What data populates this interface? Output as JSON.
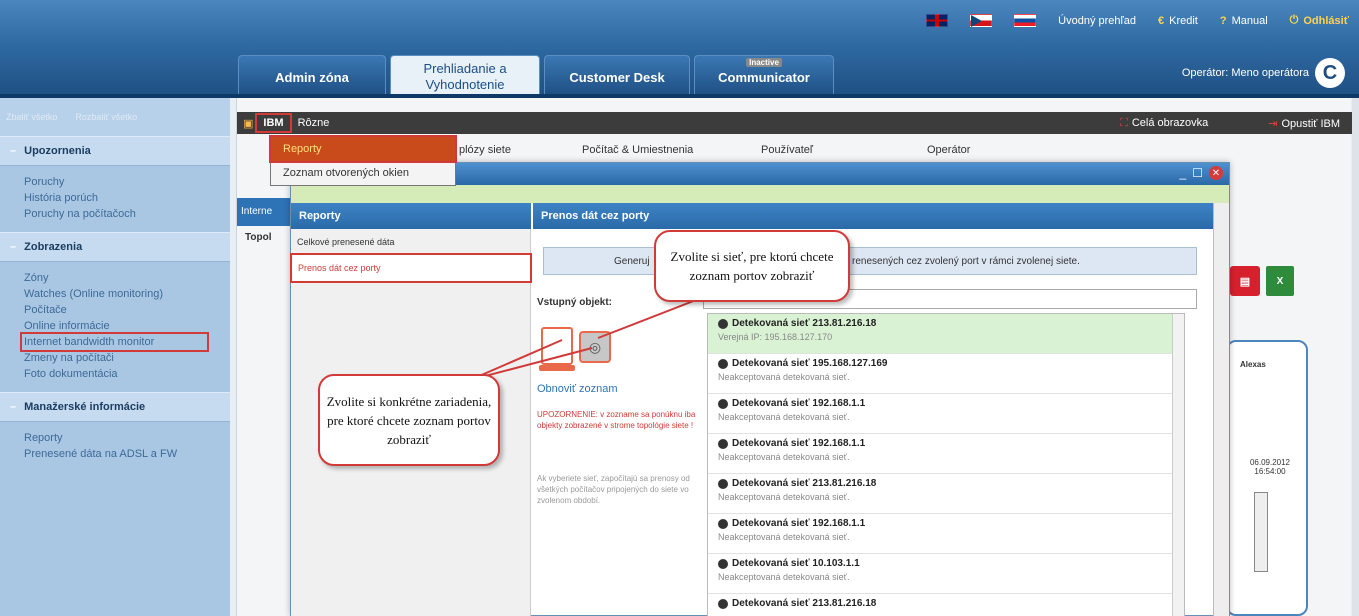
{
  "header": {
    "links": [
      {
        "label": "Úvodný prehľad"
      },
      {
        "label": "Kredit",
        "icon": "€"
      },
      {
        "label": "Manual",
        "icon": "?"
      },
      {
        "label": "Odhlásiť",
        "icon": "⏻"
      }
    ],
    "tabs": [
      {
        "label": "Admin zóna"
      },
      {
        "label": "Prehliadanie a Vyhodnotenie"
      },
      {
        "label": "Customer Desk"
      },
      {
        "label": "Communicator",
        "badge": "Inactive"
      }
    ],
    "operator": "Operátor: Meno operátora",
    "logo_letter": "C"
  },
  "sidebar": {
    "top_links": [
      "Zbaliť všetko",
      "Rozbaliť všetko"
    ],
    "sections": [
      {
        "title": "Upozornenia",
        "items": [
          "Poruchy",
          "História porúch",
          "Poruchy na počítačoch"
        ]
      },
      {
        "title": "Zobrazenia",
        "items": [
          "Zóny",
          "Watches (Online monitoring)",
          "Počítače",
          "Online informácie",
          "Internet bandwidth monitor",
          "Zmeny na počítači",
          "Foto dokumentácia"
        ]
      },
      {
        "title": "Manažerské informácie",
        "items": [
          "Reporty",
          "Prenesené dáta na ADSL a FW"
        ]
      }
    ]
  },
  "ibm_bar": {
    "ibm": "IBM",
    "menu2": "Rôzne",
    "fullscreen": "Celá obrazovka",
    "exit": "Opustiť IBM"
  },
  "background_links": {
    "link1": "plózy siete",
    "link2": "Počítač & Umiestnenia",
    "link3": "Používateľ",
    "link4": "Operátor",
    "table_head": "Interne",
    "topol": "Topol"
  },
  "dropdown": {
    "items": [
      "Reporty",
      "Zoznam otvorených okien"
    ]
  },
  "modal": {
    "left_title": "Reporty",
    "right_title": "Prenos dát cez porty",
    "left_items": [
      "Celkové prenesené dáta",
      "Prenos dát cez porty"
    ],
    "info_text": "Generuj",
    "info_tail": "renesených cez zvolený port v rámci zvolenej siete.",
    "input_label": "Vstupný objekt:",
    "refresh": "Obnoviť zoznam",
    "warning": "UPOZORNENIE: v zozname sa ponúknu iba objekty zobrazené v strome topológie siete !",
    "note": "Ak vyberiete sieť, započítajú sa prenosy od všetkých počítačov pripojených do siete vo zvolenom období.",
    "networks": [
      {
        "title": "Detekovaná sieť 213.81.216.18",
        "sub": "Verejná IP: 195.168.127.170"
      },
      {
        "title": "Detekovaná sieť 195.168.127.169",
        "sub": "Neakceptovaná detekovaná sieť."
      },
      {
        "title": "Detekovaná sieť 192.168.1.1",
        "sub": "Neakceptovaná detekovaná sieť."
      },
      {
        "title": "Detekovaná sieť 192.168.1.1",
        "sub": "Neakceptovaná detekovaná sieť."
      },
      {
        "title": "Detekovaná sieť 213.81.216.18",
        "sub": "Neakceptovaná detekovaná sieť."
      },
      {
        "title": "Detekovaná sieť 192.168.1.1",
        "sub": "Neakceptovaná detekovaná sieť."
      },
      {
        "title": "Detekovaná sieť 10.103.1.1",
        "sub": "Neakceptovaná detekovaná sieť."
      },
      {
        "title": "Detekovaná sieť 213.81.216.18",
        "sub": ""
      }
    ]
  },
  "callouts": {
    "network": "Zvolite si sieť, pre ktorú chcete zoznam portov zobraziť",
    "devices": "Zvolite si konkrétne zariadenia, pre ktoré chcete zoznam portov zobraziť"
  },
  "right_card": {
    "name": "Alexas",
    "date": "06.09.2012 16:54:00"
  },
  "colors": {
    "accent": "#2e73b5",
    "highlight": "#d23a3a"
  }
}
